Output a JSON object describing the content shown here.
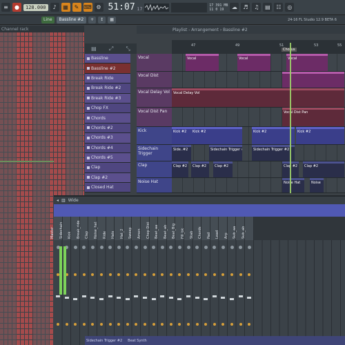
{
  "topbar": {
    "tempo": "128.000",
    "time": "51:07",
    "time_sub": "17",
    "meter_line1": "17   391 MB",
    "meter_line2": "11 0  19"
  },
  "bar2": {
    "mode": "Line",
    "pattern": "Bassline #2",
    "version": "24-16 FL Studio 12.9 BETA 6"
  },
  "rack": {
    "title": "Channel rack"
  },
  "playlist": {
    "breadcrumb": "Playlist - Arrangement › Bassline #2",
    "ruler_marks": [
      "47",
      "49",
      "51",
      "53",
      "55"
    ],
    "chorus_label": "Chorus",
    "tracks": [
      "Bassline",
      "Bassline #2",
      "Break Ride",
      "Break Ride #2",
      "Break Ride #3",
      "Chop FX",
      "Chords",
      "Chords #2",
      "Chords #3",
      "Chords #4",
      "Chords #5",
      "Clap",
      "Clap #2",
      "Closed Hat"
    ],
    "rows": [
      {
        "label": "Vocal",
        "clips": [
          {
            "text": "Vocal"
          },
          {
            "text": "Vocal"
          },
          {
            "text": "Vocal"
          }
        ]
      },
      {
        "label": "Vocal Dist",
        "clips": [
          {
            "text": ""
          }
        ]
      },
      {
        "label": "Vocal Delay Vol",
        "clips": [
          {
            "text": "Vocal Delay Vol"
          }
        ]
      },
      {
        "label": "Vocal Dist Pan",
        "clips": [
          {
            "text": "Vocal Dist Pan"
          }
        ]
      },
      {
        "label": "Kick",
        "clips": [
          {
            "text": "Kick #2"
          },
          {
            "text": "Kick #2"
          },
          {
            "text": "Kick #2"
          },
          {
            "text": "Kick #2"
          }
        ]
      },
      {
        "label": "Sidechain Trigger",
        "clips": [
          {
            "text": "Side..#2"
          },
          {
            "text": "Sidechain Trigger #2"
          },
          {
            "text": "Sidechain Trigger #2"
          }
        ]
      },
      {
        "label": "Clap",
        "clips": [
          {
            "text": "Clap #2"
          },
          {
            "text": "Clap #2"
          },
          {
            "text": "Clap #2"
          },
          {
            "text": "Clap #2"
          },
          {
            "text": "Clap #2"
          }
        ]
      },
      {
        "label": "Noise Hat",
        "clips": [
          {
            "text": "Noise Hat"
          },
          {
            "text": "Noise"
          }
        ]
      }
    ]
  },
  "mixer": {
    "preset": "Wide",
    "channels": [
      "Master",
      "Sidechain",
      "Kick",
      "Break_ride",
      "Clap",
      "Noise_hat",
      "Ride",
      "Hats",
      "Hat_2",
      "Sweep",
      "Amen",
      "Chop Dist",
      "Beat_aa",
      "Beat_ab",
      "Beat_Big",
      "Fill_bk",
      "Stab",
      "Chords",
      "Pad",
      "Lead",
      "Arp",
      "Sub_aa",
      "Sub_ab"
    ],
    "bottom_labels": [
      "Sidechain Trigger #2",
      "Beat Synth"
    ]
  },
  "colors": {
    "accent": "#d8841c",
    "mixer_strip": "#5059b4",
    "playhead": "#9ed36a"
  }
}
